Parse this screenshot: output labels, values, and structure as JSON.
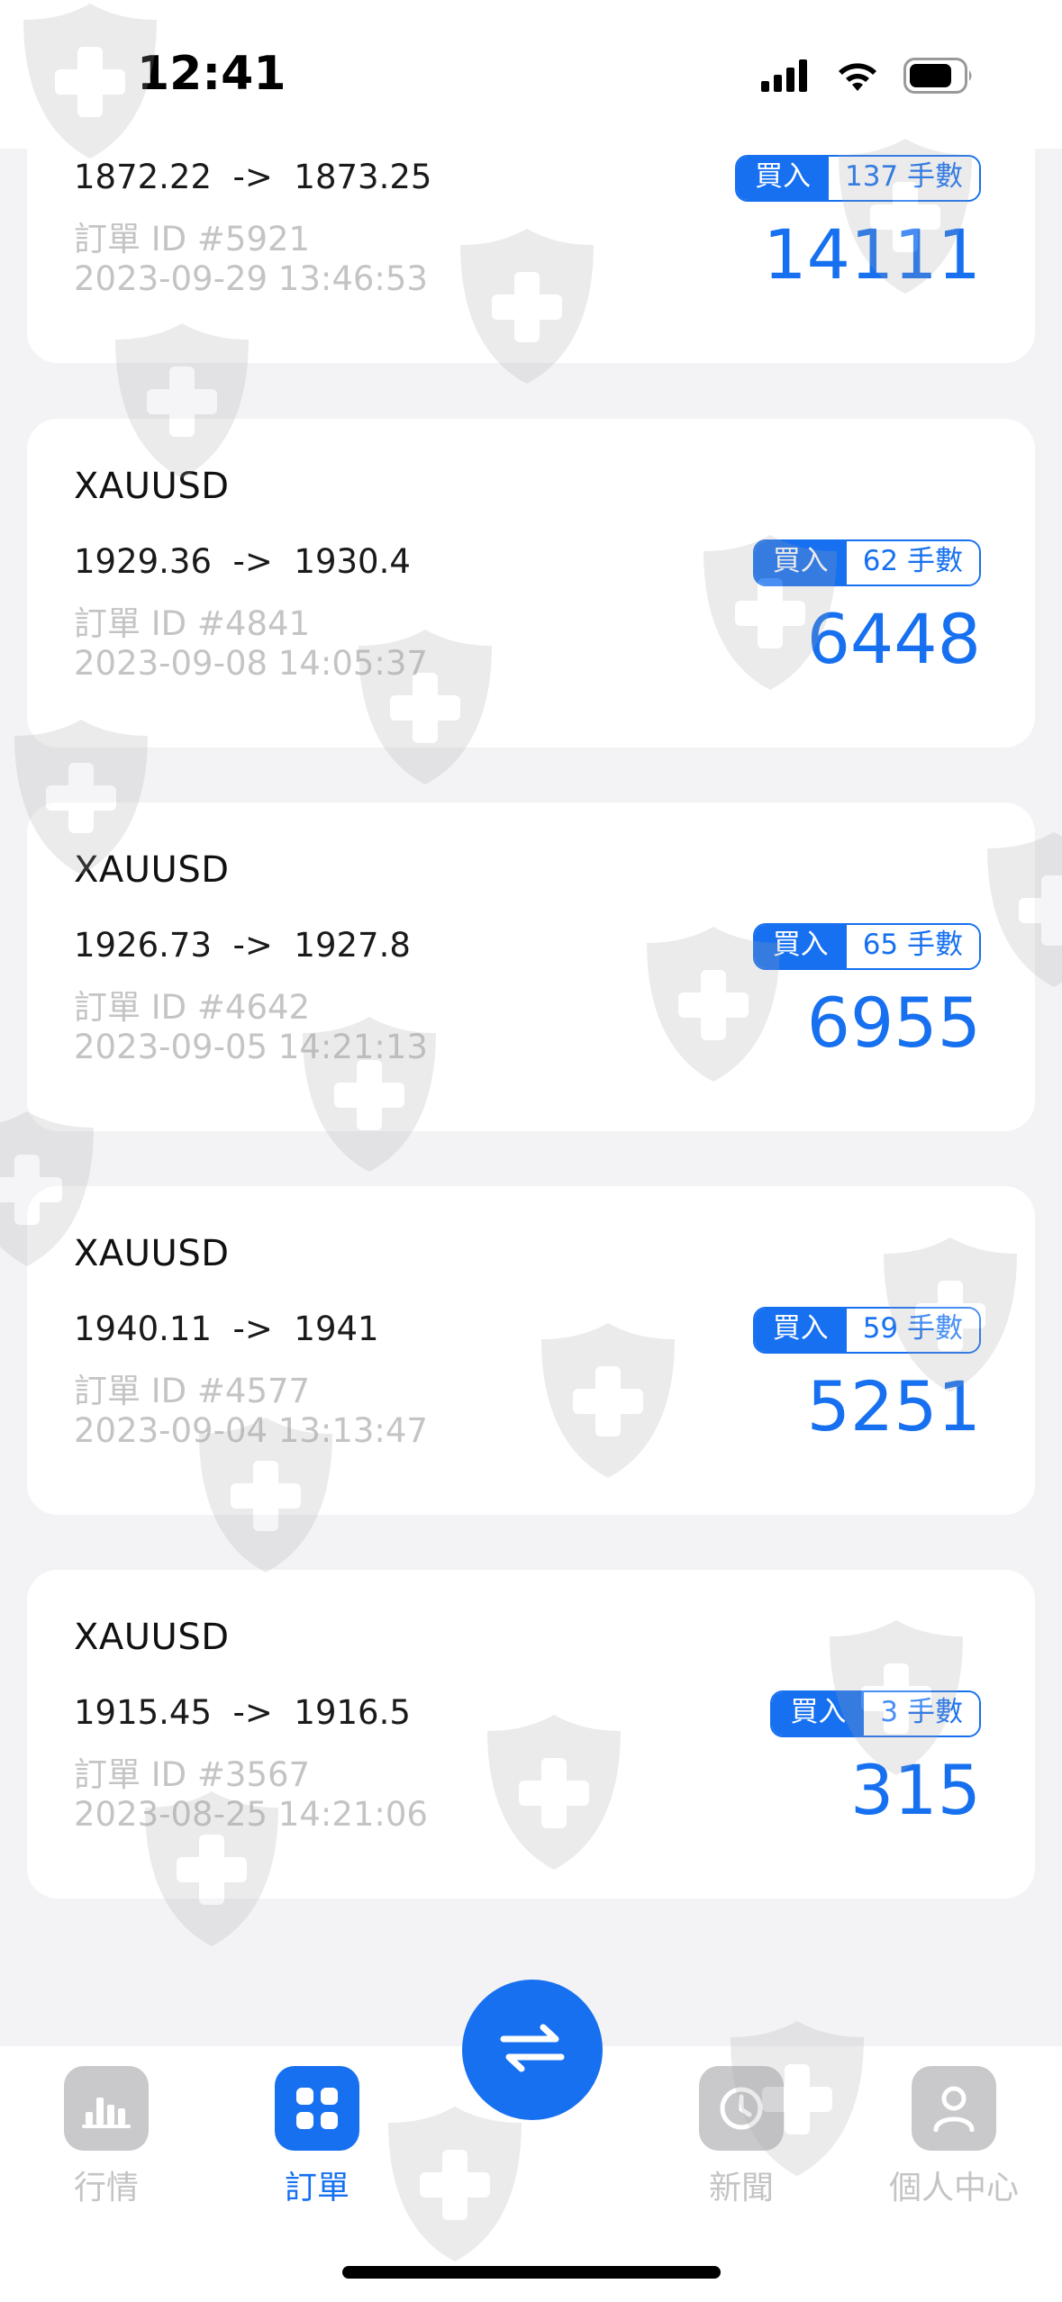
{
  "status_bar": {
    "time": "12:41",
    "icons": [
      "cellular-signal-icon",
      "wifi-icon",
      "battery-icon"
    ]
  },
  "orders": [
    {
      "symbol": "",
      "price_line": "1872.22  ->  1873.25",
      "order_id": "訂單 ID #5921",
      "timestamp": "2023-09-29 13:46:53",
      "side": "買入",
      "lots": "137 手數",
      "amount": "14111"
    },
    {
      "symbol": "XAUUSD",
      "price_line": "1929.36  ->  1930.4",
      "order_id": "訂單 ID #4841",
      "timestamp": "2023-09-08 14:05:37",
      "side": "買入",
      "lots": "62 手數",
      "amount": "6448"
    },
    {
      "symbol": "XAUUSD",
      "price_line": "1926.73  ->  1927.8",
      "order_id": "訂單 ID #4642",
      "timestamp": "2023-09-05 14:21:13",
      "side": "買入",
      "lots": "65 手數",
      "amount": "6955"
    },
    {
      "symbol": "XAUUSD",
      "price_line": "1940.11  ->  1941",
      "order_id": "訂單 ID #4577",
      "timestamp": "2023-09-04 13:13:47",
      "side": "買入",
      "lots": "59 手數",
      "amount": "5251"
    },
    {
      "symbol": "XAUUSD",
      "price_line": "1915.45  ->  1916.5",
      "order_id": "訂單 ID #3567",
      "timestamp": "2023-08-25 14:21:06",
      "side": "買入",
      "lots": "3 手數",
      "amount": "315"
    }
  ],
  "tab_bar": {
    "tabs": [
      {
        "label": "行情",
        "icon": "bar-chart-icon",
        "active": false
      },
      {
        "label": "訂單",
        "icon": "grid-icon",
        "active": true
      },
      {
        "label": "新聞",
        "icon": "clock-icon",
        "active": false
      },
      {
        "label": "個人中心",
        "icon": "person-icon",
        "active": false
      }
    ],
    "center_action_icon": "swap-arrows-icon"
  },
  "colors": {
    "accent": "#1670f0",
    "muted_text": "#c4c4c6",
    "background": "#f3f3f5",
    "card": "#ffffff"
  },
  "watermark_icon": "shield-cross-icon"
}
